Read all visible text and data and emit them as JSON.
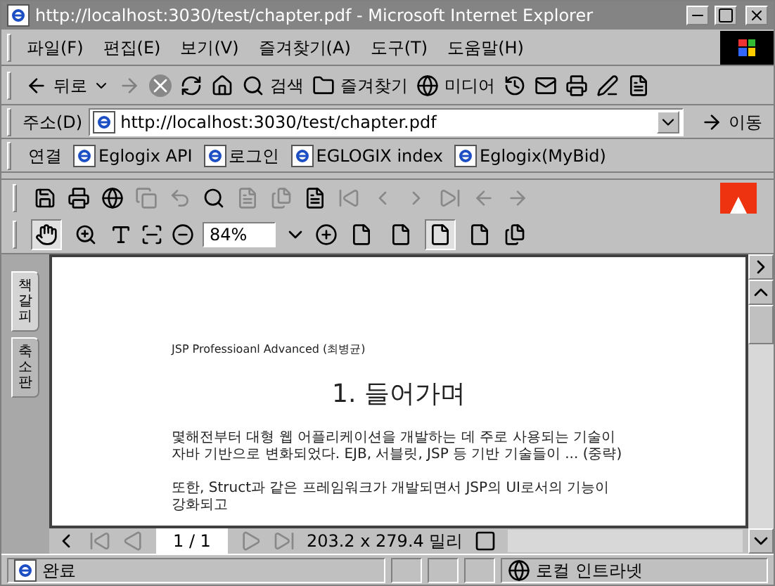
{
  "window": {
    "title": "http://localhost:3030/test/chapter.pdf - Microsoft Internet Explorer"
  },
  "menu": [
    "파일(F)",
    "편집(E)",
    "보기(V)",
    "즐겨찾기(A)",
    "도구(T)",
    "도움말(H)"
  ],
  "toolbar": {
    "back": "뒤로",
    "search": "검색",
    "favorites": "즐겨찾기",
    "media": "미디어"
  },
  "address": {
    "label": "주소(D)",
    "value": "http://localhost:3030/test/chapter.pdf",
    "go": "이동"
  },
  "links": {
    "label": "연결",
    "items": [
      "Eglogix API",
      "로그인",
      "EGLOGIX index",
      "Eglogix(MyBid)"
    ]
  },
  "acrobat": {
    "zoom": "84%",
    "tools": [
      {
        "selected": true
      },
      {
        "selected": false
      }
    ],
    "views": [
      {
        "selected": false
      },
      {
        "selected": false
      },
      {
        "selected": true
      },
      {
        "selected": false
      }
    ]
  },
  "side_tabs": [
    {
      "label": "책갈피",
      "selected": true
    },
    {
      "label": "축소판",
      "selected": false
    }
  ],
  "document": {
    "header": "JSP Professioanl Advanced (최병균)",
    "heading": "1. 들어가며",
    "paragraphs": [
      "몇해전부터 대형 웹 어플리케이션을 개발하는 데 주로 사용되는 기술이 자바 기반으로 변화되었다. EJB, 서블릿, JSP 등 기반 기술들이 ... (중략)",
      "또한, Struct과 같은 프레임워크가 개발되면서 JSP의 UI로서의 기능이 강화되고"
    ]
  },
  "page_nav": {
    "page": "1 / 1",
    "size": "203.2 x 279.4 밀리"
  },
  "status_bar": {
    "text": "완료",
    "zone": "로컬 인트라넷"
  }
}
